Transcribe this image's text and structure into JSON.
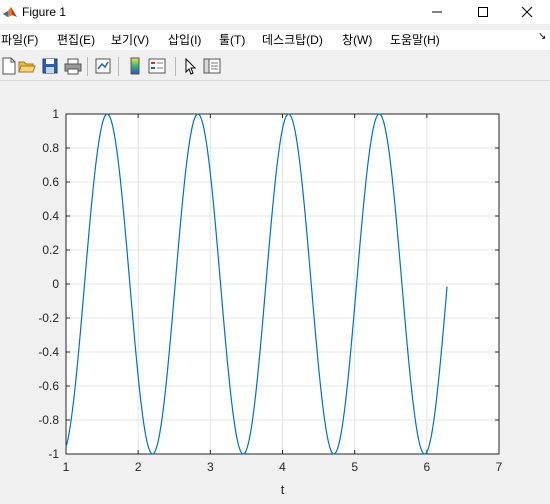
{
  "window": {
    "title": "Figure 1",
    "minimize_glyph": "—",
    "close_glyph": "✕"
  },
  "menu": [
    {
      "label": "파일(F)"
    },
    {
      "label": "편집(E)"
    },
    {
      "label": "보기(V)"
    },
    {
      "label": "삽입(I)"
    },
    {
      "label": "툴(T)"
    },
    {
      "label": "데스크탑(D)"
    },
    {
      "label": "창(W)"
    },
    {
      "label": "도움말(H)"
    }
  ],
  "menu_overflow_glyph": "↘",
  "toolbar": [
    {
      "icon": "new-figure-icon"
    },
    {
      "icon": "open-file-icon"
    },
    {
      "icon": "save-icon"
    },
    {
      "icon": "print-icon"
    },
    {
      "icon": "link-plot-icon"
    },
    {
      "icon": "insert-colorbar-icon"
    },
    {
      "icon": "insert-legend-icon"
    },
    {
      "icon": "edit-plot-icon"
    },
    {
      "icon": "property-inspector-icon"
    }
  ],
  "colors": {
    "line": "#0072bd",
    "grid": "#e6e6e6",
    "axes_bg": "#ffffff",
    "figure_bg": "#f0f0f0"
  },
  "chart_data": {
    "type": "line",
    "title": "",
    "xlabel": "t",
    "ylabel": "",
    "xlim": [
      1,
      7
    ],
    "ylim": [
      -1,
      1
    ],
    "xticks": [
      "1",
      "2",
      "3",
      "4",
      "5",
      "6",
      "7"
    ],
    "yticks": [
      "1",
      "0.8",
      "0.6",
      "0.4",
      "0.2",
      "0",
      "-0.2",
      "-0.4",
      "-0.6",
      "-0.8",
      "-1"
    ],
    "grid": true,
    "series": [
      {
        "function": "sin(5*t)",
        "x_start": 1,
        "x_end": 6.28
      }
    ]
  }
}
